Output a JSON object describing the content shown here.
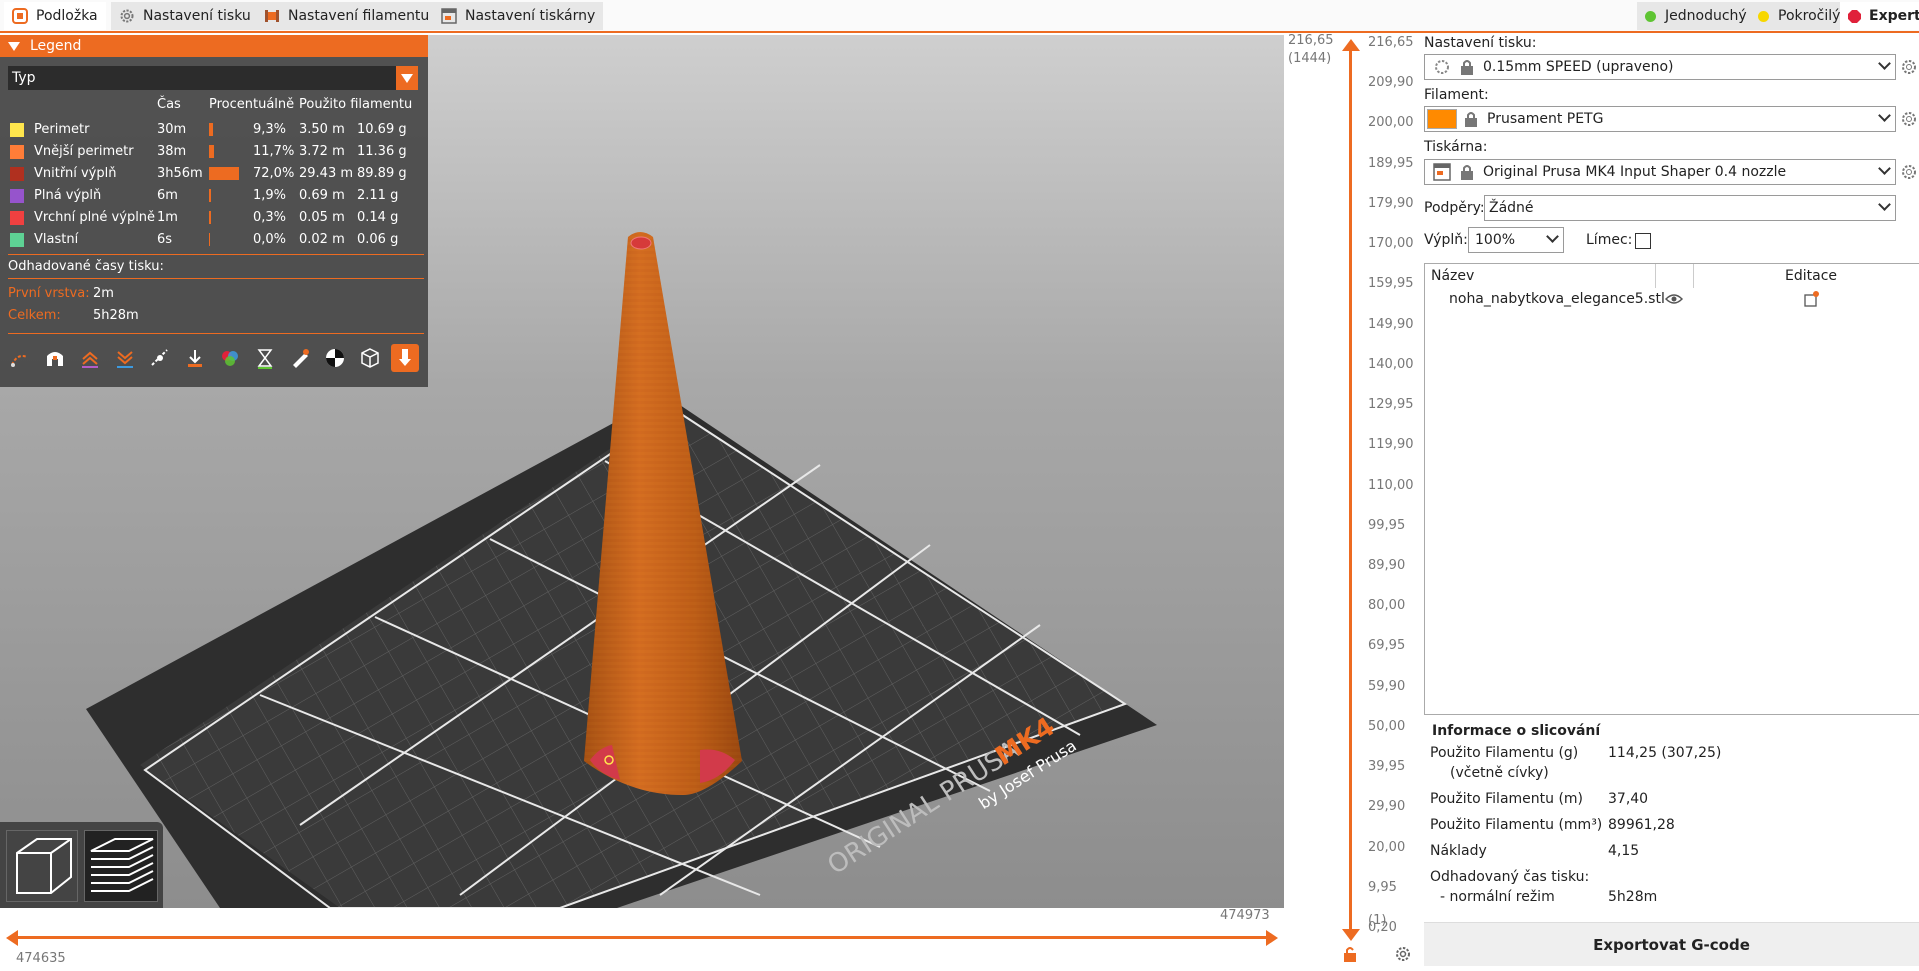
{
  "tabs": [
    {
      "label": "Podložka",
      "icon": "plater-icon"
    },
    {
      "label": "Nastavení tisku",
      "icon": "gear-icon"
    },
    {
      "label": "Nastavení filamentu",
      "icon": "filament-spool-icon"
    },
    {
      "label": "Nastavení tiskárny",
      "icon": "printer-icon"
    }
  ],
  "modes": [
    {
      "label": "Jednoduchý",
      "color": "#5ec432"
    },
    {
      "label": "Pokročilý",
      "color": "#f7d700"
    },
    {
      "label": "Expert",
      "color": "#e0213a"
    }
  ],
  "legend": {
    "title": "Legend",
    "view_type": "Typ",
    "columns": {
      "time": "Čas",
      "percent": "Procentuálně",
      "filament": "Použito filamentu"
    },
    "rows": [
      {
        "name": "Perimetr",
        "color": "#ffe64d",
        "time": "30m",
        "percent": "9,3%",
        "length": "3.50 m",
        "weight": "10.69 g",
        "share": 0.093
      },
      {
        "name": "Vnější perimetr",
        "color": "#ff7d38",
        "time": "38m",
        "percent": "11,7%",
        "length": "3.72 m",
        "weight": "11.36 g",
        "share": 0.117
      },
      {
        "name": "Vnitřní výplň",
        "color": "#b0301f",
        "time": "3h56m",
        "percent": "72,0%",
        "length": "29.43 m",
        "weight": "89.89 g",
        "share": 0.72
      },
      {
        "name": "Plná výplň",
        "color": "#9654cc",
        "time": "6m",
        "percent": "1,9%",
        "length": "0.69 m",
        "weight": "2.11 g",
        "share": 0.019
      },
      {
        "name": "Vrchní plné výplně",
        "color": "#f04040",
        "time": "1m",
        "percent": "0,3%",
        "length": "0.05 m",
        "weight": "0.14 g",
        "share": 0.003
      },
      {
        "name": "Vlastní",
        "color": "#5ed194",
        "time": "6s",
        "percent": "0,0%",
        "length": "0.02 m",
        "weight": "0.06 g",
        "share": 0.0
      }
    ],
    "estimated_label": "Odhadované časy tisku:",
    "first_layer_label": "První vrstva:",
    "first_layer_value": "2m",
    "total_label": "Celkem:",
    "total_value": "5h28m"
  },
  "bed": {
    "brand": "ORIGINAL PRUSA",
    "model": "MK4",
    "byline": "by Josef Prusa"
  },
  "hslider": {
    "right_label": "474973",
    "left_label": "474635"
  },
  "vslider": {
    "top_value": "216,65",
    "top_layer": "(1444)",
    "bottom_value": "0,20",
    "bottom_layer": "(1)",
    "ticks": [
      "216,65",
      "209,90",
      "200,00",
      "189,95",
      "179,90",
      "170,00",
      "159,95",
      "149,90",
      "140,00",
      "129,95",
      "119,90",
      "110,00",
      "99,95",
      "89,90",
      "80,00",
      "69,95",
      "59,90",
      "50,00",
      "39,95",
      "29,90",
      "20,00",
      "9,95",
      "0,20"
    ]
  },
  "panel": {
    "print_label": "Nastavení tisku:",
    "print_value": "0.15mm SPEED (upraveno)",
    "filament_label": "Filament:",
    "filament_value": "Prusament PETG",
    "filament_color": "#ff8a00",
    "printer_label": "Tiskárna:",
    "printer_value": "Original Prusa MK4 Input Shaper 0.4 nozzle",
    "supports_label": "Podpěry:",
    "supports_value": "Žádné",
    "infill_label": "Výplň:",
    "infill_value": "100%",
    "brim_label": "Límec:",
    "list_col_name": "Název",
    "list_col_edit": "Editace",
    "object_name": "noha_nabytkova_elegance5.stl",
    "info_title": "Informace o slicování",
    "info": [
      {
        "label": "Použito Filamentu (g)",
        "sub": "(včetně cívky)",
        "value": "114,25 (307,25)"
      },
      {
        "label": "Použito Filamentu (m)",
        "value": "37,40"
      },
      {
        "label": "Použito Filamentu (mm³)",
        "value": "89961,28"
      },
      {
        "label": "Náklady",
        "value": "4,15"
      },
      {
        "label": "Odhadovaný čas tisku:",
        "value": ""
      },
      {
        "label": "- normální režim",
        "value": "5h28m"
      }
    ],
    "export_label": "Exportovat G-code"
  }
}
